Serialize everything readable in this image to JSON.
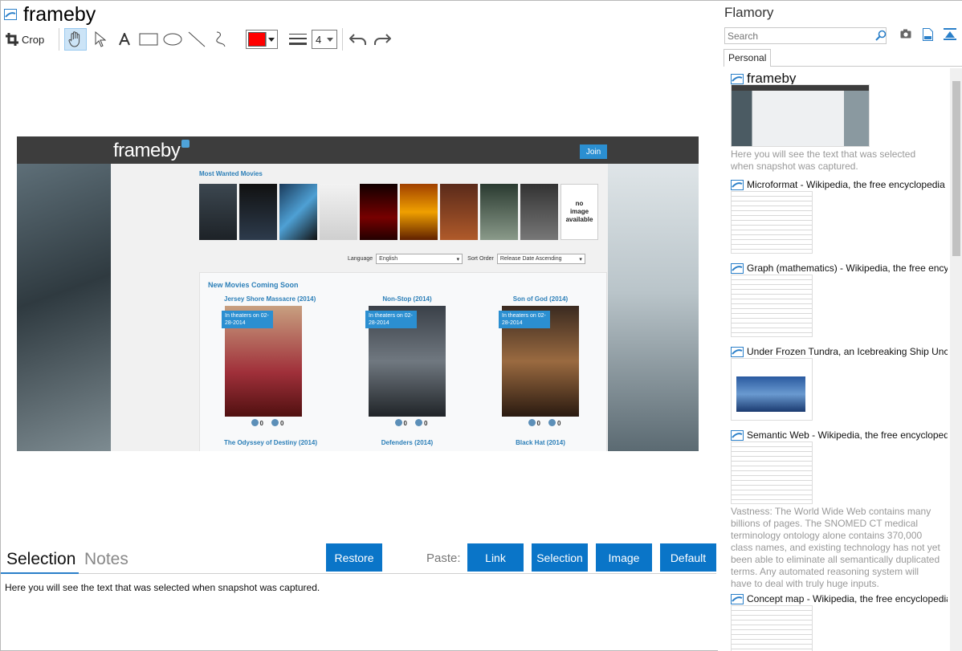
{
  "editor": {
    "doc_title": "frameby",
    "toolbar": {
      "crop_label": "Crop",
      "line_width": "4",
      "color": "#ff0000"
    },
    "screenshot": {
      "logo": "frameby",
      "join_label": "Join",
      "most_wanted": "Most Wanted Movies",
      "no_image": [
        "no",
        "image",
        "available"
      ],
      "language_label": "Language",
      "language_value": "English",
      "sort_label": "Sort Order",
      "sort_value": "Release Date Ascending",
      "new_movies": "New Movies Coming Soon",
      "movies": [
        {
          "title": "Jersey Shore Massacre (2014)",
          "ribbon": "In theaters on 02-28-2014",
          "up": "0",
          "down": "0"
        },
        {
          "title": "Non-Stop (2014)",
          "ribbon": "In theaters on 02-28-2014",
          "up": "0",
          "down": "0"
        },
        {
          "title": "Son of God (2014)",
          "ribbon": "In theaters on 02-28-2014",
          "up": "0",
          "down": "0"
        },
        {
          "title": "The Odyssey of Destiny (2014)"
        },
        {
          "title": "Defenders (2014)"
        },
        {
          "title": "Black Hat (2014)"
        }
      ]
    },
    "panel": {
      "tab_selection": "Selection",
      "tab_notes": "Notes",
      "restore_label": "Restore",
      "paste_label": "Paste:",
      "paste_buttons": [
        "Link",
        "Selection",
        "Image",
        "Default"
      ],
      "selection_text": "Here you will see the text that was selected when snapshot was captured."
    }
  },
  "sidebar": {
    "title": "Flamory",
    "search_placeholder": "Search",
    "tab": "Personal",
    "items": [
      {
        "title": "frameby",
        "desc": "Here you will see the text that was selected when snapshot was captured."
      },
      {
        "title": "Microformat - Wikipedia, the free encyclopedia"
      },
      {
        "title": "Graph (mathematics) - Wikipedia, the free encyclopedia"
      },
      {
        "title": "Under Frozen Tundra, an Icebreaking Ship Uncovers"
      },
      {
        "title": "Semantic Web - Wikipedia, the free encyclopedia",
        "desc": "Vastness: The World Wide Web contains many billions of pages. The SNOMED CT medical terminology ontology alone contains 370,000 class names, and existing technology has not yet been able to eliminate all semantically duplicated terms. Any automated reasoning system will have to deal with truly huge inputs."
      },
      {
        "title": "Concept map - Wikipedia, the free encyclopedia"
      }
    ]
  },
  "colors": {
    "accent": "#0a75c8",
    "brand_blue": "#2c7fb8"
  }
}
